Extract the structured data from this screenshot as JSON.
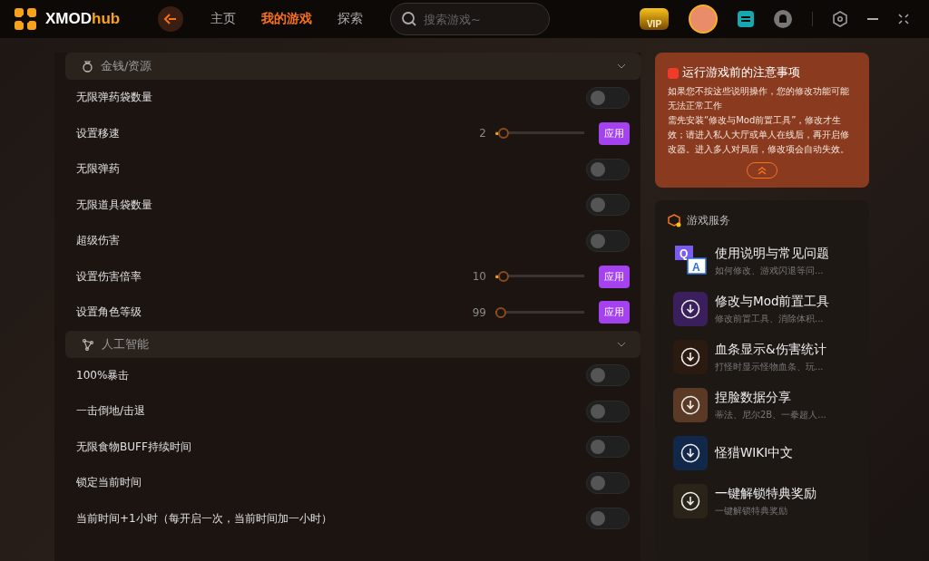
{
  "logo": {
    "main": "XMOD",
    "accent": "hub"
  },
  "nav": [
    {
      "label": "主页",
      "selected": false
    },
    {
      "label": "我的游戏",
      "selected": true
    },
    {
      "label": "探索",
      "selected": false
    }
  ],
  "search": {
    "placeholder": "搜索游戏~"
  },
  "vip_badge": "VIP",
  "sections": [
    {
      "title": "金钱/资源",
      "expanded": true,
      "items": [
        {
          "kind": "toggle",
          "label": "无限弹药袋数量",
          "on": false
        },
        {
          "kind": "slider",
          "label": "设置移速",
          "reading": "2",
          "level": 0.04,
          "button": "应用"
        },
        {
          "kind": "toggle",
          "label": "无限弹药",
          "on": false
        },
        {
          "kind": "toggle",
          "label": "无限道具袋数量",
          "on": false
        },
        {
          "kind": "toggle",
          "label": "超级伤害",
          "on": false
        },
        {
          "kind": "slider",
          "label": "设置伤害倍率",
          "reading": "10",
          "level": 0.04,
          "button": "应用"
        },
        {
          "kind": "slider",
          "label": "设置角色等级",
          "reading": "99",
          "level": 0,
          "button": "应用"
        }
      ]
    },
    {
      "title": "人工智能",
      "expanded": true,
      "items": [
        {
          "kind": "toggle",
          "label": "100%暴击",
          "on": false
        },
        {
          "kind": "toggle",
          "label": "一击倒地/击退",
          "on": false
        },
        {
          "kind": "toggle",
          "label": "无限食物BUFF持续时间",
          "on": false
        },
        {
          "kind": "toggle",
          "label": "锁定当前时间",
          "on": false
        },
        {
          "kind": "toggle",
          "label": "当前时间+1小时（每开启一次，当前时间加一小时）",
          "on": false
        }
      ]
    }
  ],
  "notice": {
    "title": "运行游戏前的注意事项",
    "paragraphs": [
      "如果您不按这些说明操作，您的修改功能可能无法正常工作",
      "需先安装“修改与Mod前置工具”，修改才生效；请进入私人大厅或单人在线后，再开启修改器。进入多人对局后，修改项会自动失效。"
    ],
    "expanded": true
  },
  "services": {
    "title": "游戏服务",
    "items": [
      {
        "kind": "qa",
        "title": "使用说明与常见问题",
        "subtitle": "如何修改、游戏闪退等问...",
        "letters": [
          "Q",
          "A"
        ]
      },
      {
        "kind": "download",
        "title": "修改与Mod前置工具",
        "subtitle": "修改前置工具、消除体积...",
        "color": "#3a1f5c"
      },
      {
        "kind": "download",
        "title": "血条显示&伤害统计",
        "subtitle": "打怪时显示怪物血条、玩...",
        "color": "#2a1a10"
      },
      {
        "kind": "download",
        "title": "捏脸数据分享",
        "subtitle": "蒂法、尼尔2B、一拳超人...",
        "color": "#5a3a25"
      },
      {
        "kind": "download",
        "title": "怪猎WIKI中文",
        "color": "#12284a"
      },
      {
        "kind": "download",
        "title": "一键解锁特典奖励",
        "subtitle": "一键解锁特典奖励",
        "color": "#2a2418"
      }
    ]
  }
}
